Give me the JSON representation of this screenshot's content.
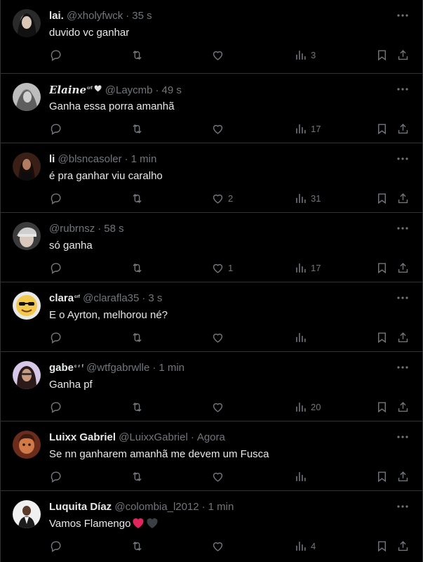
{
  "colors": {
    "background": "#000000",
    "divider": "#2f3336",
    "primary_text": "#e7e9ea",
    "secondary_text": "#71767b",
    "red_heart": "#e0245e",
    "black_heart": "#3b3f44"
  },
  "icons": {
    "reply": "reply-icon",
    "retweet": "retweet-icon",
    "like": "like-icon",
    "views": "views-icon",
    "bookmark": "bookmark-icon",
    "share": "share-icon",
    "more": "more-icon"
  },
  "replies": [
    {
      "display_name": "lai.",
      "handle": "@xholyfwck",
      "time": "35 s",
      "text": "duvido vc ganhar",
      "likes": "",
      "views": "3"
    },
    {
      "display_name": "𝑬𝒍𝒂𝒊𝒏𝒆",
      "name_suffix": "ᶜʳᶠ 🤍",
      "handle": "@Laycmb",
      "time": "49 s",
      "text": "Ganha essa porra amanhã",
      "likes": "",
      "views": "17"
    },
    {
      "display_name": "li",
      "handle": "@blsncasoler",
      "time": "1 min",
      "text": "é pra ganhar viu caralho",
      "likes": "2",
      "views": "31"
    },
    {
      "display_name": "",
      "handle": "@rubrnsz",
      "time": "58 s",
      "text": "só ganha",
      "likes": "1",
      "views": "17"
    },
    {
      "display_name": "clara",
      "name_suffix": "ᶜʳᶠ",
      "handle": "@clarafla35",
      "time": "3 s",
      "text": "E o Ayrton, melhorou né?",
      "likes": "",
      "views": ""
    },
    {
      "display_name": "gabe",
      "name_suffix": "ᶜ ʳ ᶠ",
      "handle": "@wtfgabrwlle",
      "time": "1 min",
      "text": "Ganha pf",
      "likes": "",
      "views": "20"
    },
    {
      "display_name": "Luixx Gabriel",
      "handle": "@LuixxGabriel",
      "time": "Agora",
      "text": "Se nn ganharem amanhã me devem um Fusca",
      "likes": "",
      "views": ""
    },
    {
      "display_name": "Luquita Díaz",
      "handle": "@colombia_l2012",
      "time": "1 min",
      "text": "Vamos Flamengo",
      "likes": "",
      "views": "4"
    }
  ]
}
